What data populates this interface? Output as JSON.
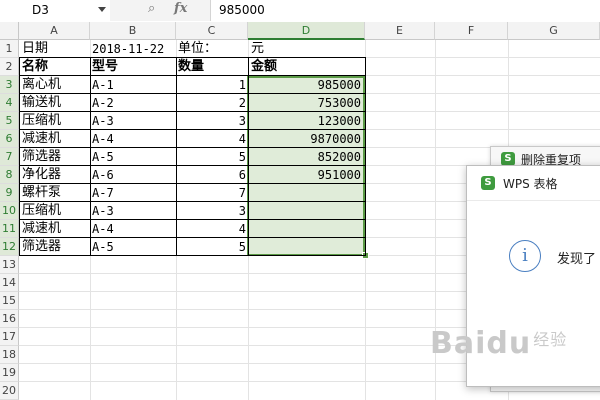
{
  "formula_bar": {
    "name_box": "D3",
    "zoom_icon": "magnifier-icon",
    "fx_label": "fx",
    "value": "985000"
  },
  "columns": [
    "A",
    "B",
    "C",
    "D",
    "E",
    "F",
    "G"
  ],
  "rows": [
    "1",
    "2",
    "3",
    "4",
    "5",
    "6",
    "7",
    "8",
    "9",
    "10",
    "11",
    "12",
    "13",
    "14",
    "15",
    "16",
    "17",
    "18",
    "19",
    "20"
  ],
  "sheet": {
    "row1": {
      "a": "日期",
      "b": "2018-11-22",
      "c": "单位：",
      "d": "元"
    },
    "headers": {
      "a": "名称",
      "b": "型号",
      "c": "数量",
      "d": "金额"
    },
    "data": [
      {
        "name": "离心机",
        "model": "A-1",
        "qty": "1",
        "amount": "985000"
      },
      {
        "name": "输送机",
        "model": "A-2",
        "qty": "2",
        "amount": "753000"
      },
      {
        "name": "压缩机",
        "model": "A-3",
        "qty": "3",
        "amount": "123000"
      },
      {
        "name": "减速机",
        "model": "A-4",
        "qty": "4",
        "amount": "9870000"
      },
      {
        "name": "筛选器",
        "model": "A-5",
        "qty": "5",
        "amount": "852000"
      },
      {
        "name": "净化器",
        "model": "A-6",
        "qty": "6",
        "amount": "951000"
      },
      {
        "name": "螺杆泵",
        "model": "A-7",
        "qty": "7",
        "amount": ""
      },
      {
        "name": "压缩机",
        "model": "A-3",
        "qty": "3",
        "amount": ""
      },
      {
        "name": "减速机",
        "model": "A-4",
        "qty": "4",
        "amount": ""
      },
      {
        "name": "筛选器",
        "model": "A-5",
        "qty": "5",
        "amount": ""
      }
    ]
  },
  "dialog_back": {
    "title": "删除重复项",
    "icon": "wps-sheet-icon"
  },
  "dialog_front": {
    "title": "WPS 表格",
    "icon": "wps-sheet-icon",
    "info_icon": "info-icon",
    "message": "发现了"
  },
  "watermark": {
    "text": "Bai",
    "paw": "du",
    "suffix": "经验"
  },
  "colors": {
    "selection": "#5b9a46",
    "selection_fill": "#dfe9d8",
    "wps_green": "#3f9b3f",
    "info_blue": "#4a7fc1"
  }
}
